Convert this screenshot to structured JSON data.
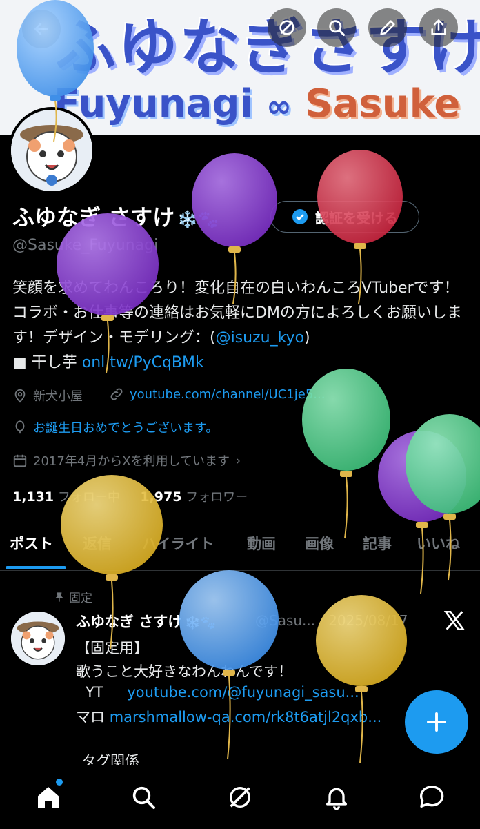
{
  "banner": {
    "title_jp": "ふゆなぎさすけ",
    "title_en_a": "Fuyunagi",
    "title_en_b": "Sasuke"
  },
  "profile": {
    "name": "ふゆなぎ さすけ",
    "name_emoji": "❄️🐾",
    "verify_label": "認証を受ける",
    "handle": "@Sasuke_Fuyunagi",
    "bio_part1": "笑顔を求めてわんころり！変化自在の白いわんころVTuberです！コラボ・お仕事等の連絡はお気軽にDMの方によろしくお願いします！デザイン・モデリング：(",
    "bio_mention": "@isuzu_kyo",
    "bio_part2": ")",
    "bio_line2_prefix": "■ 干し芋 ",
    "bio_link": "onl.tw/PyCqBMk",
    "location": "新犬小屋",
    "website": "youtube.com/channel/UC1je5...",
    "birthday": "お誕生日おめでとうございます。",
    "joined": "2017年4月からXを利用しています",
    "following_count": "1,131",
    "following_label": "フォロー中",
    "followers_count": "1,975",
    "followers_label": "フォロワー"
  },
  "tabs": [
    "ポスト",
    "返信",
    "ハイライト",
    "動画",
    "画像",
    "記事",
    "いいね"
  ],
  "pinned_post": {
    "pinned_label": "固定",
    "author": "ふゆなぎ さすけ",
    "author_emoji": "❄️🐾",
    "handle_date": "@Sasu... · 2025/08/17",
    "line1": "【固定用】",
    "line2": "歌うこと大好きなわんわんです！",
    "line3_label": "YT",
    "line3_link": "youtube.com/@fuyunagi_sasu...",
    "line4_label": "マロ",
    "line4_link": "marshmallow-qa.com/rk8t6atjl2qxb...",
    "line5": "タグ関係"
  },
  "icons": {
    "header": [
      "back-icon",
      "grok-icon",
      "search-icon",
      "edit-icon",
      "share-icon"
    ],
    "nav": [
      "home-icon",
      "search-icon",
      "grok-icon",
      "bell-icon",
      "message-icon"
    ],
    "fab": "plus-icon",
    "brand": "x-logo"
  },
  "colors": {
    "accent": "#1d9bf0",
    "balloon_blue": "#4a9ef5",
    "balloon_purple": "#8a3fd1",
    "balloon_red": "#d9334f",
    "balloon_green": "#4ccf8a",
    "balloon_yellow": "#e8c035"
  }
}
